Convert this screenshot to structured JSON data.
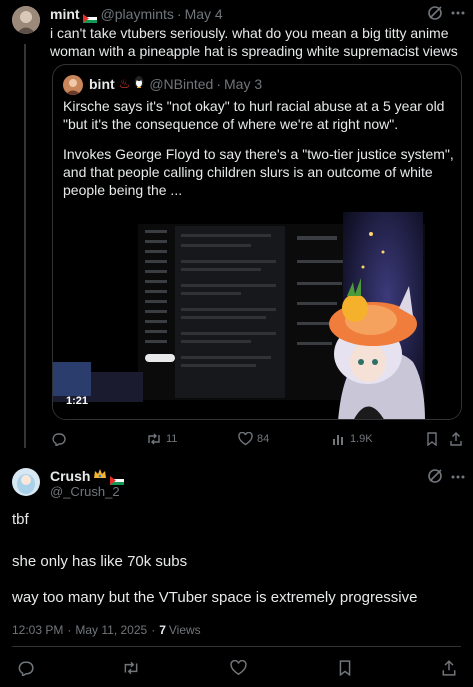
{
  "post1": {
    "name": "mint",
    "handle": "@playmints",
    "date": "May 4",
    "text": "i can't take vtubers seriously. what do you mean a big titty anime woman with a pineapple hat is spreading white supremacist views",
    "actions": {
      "replies": "",
      "reposts": "11",
      "likes": "84",
      "views": "1.9K"
    }
  },
  "quote": {
    "name": "bint",
    "handle": "@NBinted",
    "date": "May 3",
    "paragraph1": "Kirsche says it's \"not okay\" to hurl racial abuse at a 5 year old \"but it's the consequence of where we're at right now\".",
    "paragraph2": "Invokes George Floyd to say there's a \"two-tier justice system\", and that people calling children slurs is an outcome of white people being the ...",
    "video_duration": "1:21"
  },
  "post2": {
    "name": "Crush",
    "handle": "@_Crush_2",
    "lines": [
      "tbf",
      "she only has like 70k subs",
      "way too many but the VTuber space is extremely progressive"
    ],
    "time": "12:03 PM",
    "sep": "·",
    "date": "May 11, 2025",
    "views_count": "7",
    "views_label": "Views"
  },
  "icons": [
    "reply-icon",
    "repost-icon",
    "like-icon",
    "views-icon",
    "bookmark-icon",
    "share-icon",
    "grok-icon"
  ],
  "colors": {
    "background": "#000000",
    "text": "#e7e9ea",
    "muted": "#71767b",
    "border": "#2f3336"
  }
}
